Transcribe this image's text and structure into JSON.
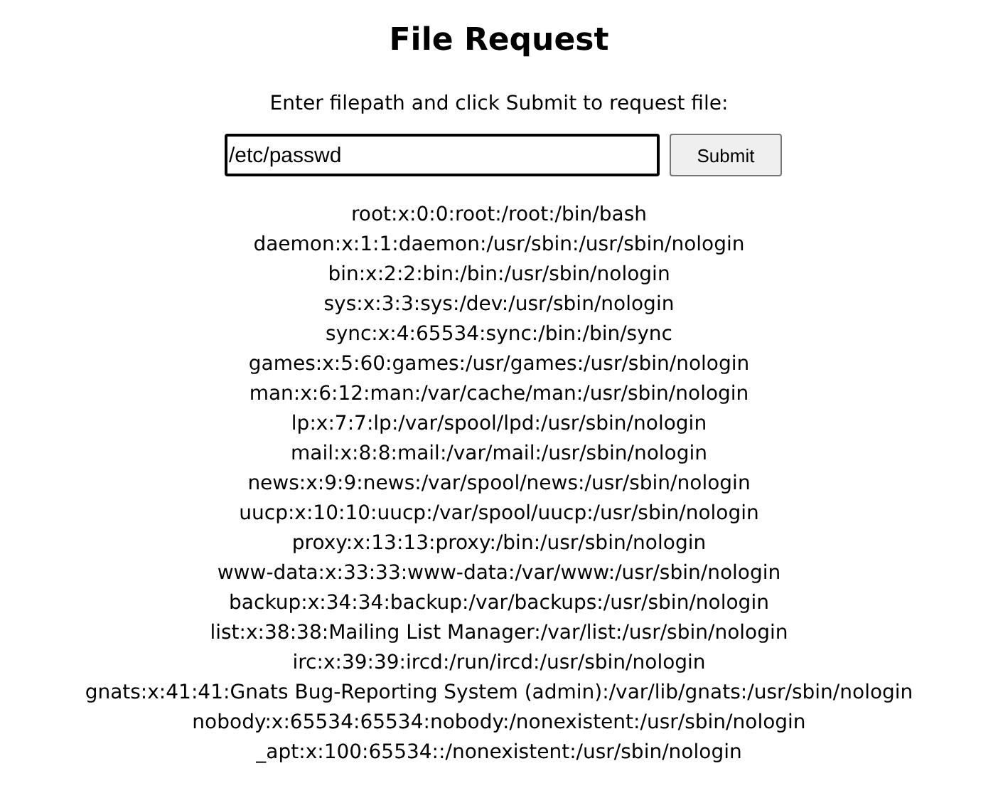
{
  "title": "File Request",
  "instruction": "Enter filepath and click Submit to request file:",
  "filepath_field": {
    "value": "/etc/passwd"
  },
  "submit_button": "Submit",
  "file_lines": [
    "root:x:0:0:root:/root:/bin/bash",
    "daemon:x:1:1:daemon:/usr/sbin:/usr/sbin/nologin",
    "bin:x:2:2:bin:/bin:/usr/sbin/nologin",
    "sys:x:3:3:sys:/dev:/usr/sbin/nologin",
    "sync:x:4:65534:sync:/bin:/bin/sync",
    "games:x:5:60:games:/usr/games:/usr/sbin/nologin",
    "man:x:6:12:man:/var/cache/man:/usr/sbin/nologin",
    "lp:x:7:7:lp:/var/spool/lpd:/usr/sbin/nologin",
    "mail:x:8:8:mail:/var/mail:/usr/sbin/nologin",
    "news:x:9:9:news:/var/spool/news:/usr/sbin/nologin",
    "uucp:x:10:10:uucp:/var/spool/uucp:/usr/sbin/nologin",
    "proxy:x:13:13:proxy:/bin:/usr/sbin/nologin",
    "www-data:x:33:33:www-data:/var/www:/usr/sbin/nologin",
    "backup:x:34:34:backup:/var/backups:/usr/sbin/nologin",
    "list:x:38:38:Mailing List Manager:/var/list:/usr/sbin/nologin",
    "irc:x:39:39:ircd:/run/ircd:/usr/sbin/nologin",
    "gnats:x:41:41:Gnats Bug-Reporting System (admin):/var/lib/gnats:/usr/sbin/nologin",
    "nobody:x:65534:65534:nobody:/nonexistent:/usr/sbin/nologin",
    "_apt:x:100:65534::/nonexistent:/usr/sbin/nologin"
  ]
}
